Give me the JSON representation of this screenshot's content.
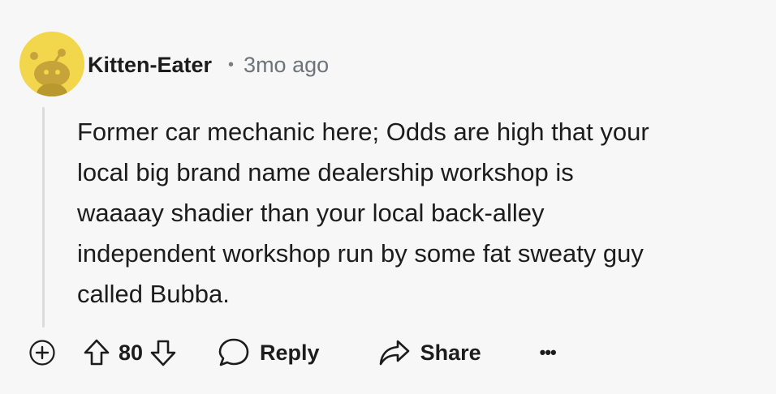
{
  "comment": {
    "username": "Kitten-Eater",
    "separator": "•",
    "timestamp": "3mo ago",
    "body_lines": [
      "Former car mechanic here; Odds are high that your",
      "local big brand name dealership workshop is",
      "waaaay shadier than your local back-alley",
      "independent workshop run by some fat sweaty guy",
      "called Bubba."
    ],
    "avatar_icon": "snoo-avatar-icon",
    "colors": {
      "avatar_bg": "#f2d64b",
      "avatar_figure": "#c6a43a",
      "text": "#1c1c1c",
      "muted": "#6f7378",
      "background": "#f7f7f8"
    }
  },
  "actions": {
    "expand_icon": "plus-circle-icon",
    "upvote_icon": "arrow-up-icon",
    "vote_count": "80",
    "downvote_icon": "arrow-down-icon",
    "reply_icon": "speech-bubble-icon",
    "reply_label": "Reply",
    "share_icon": "share-arrow-icon",
    "share_label": "Share",
    "more_label": "•••"
  }
}
